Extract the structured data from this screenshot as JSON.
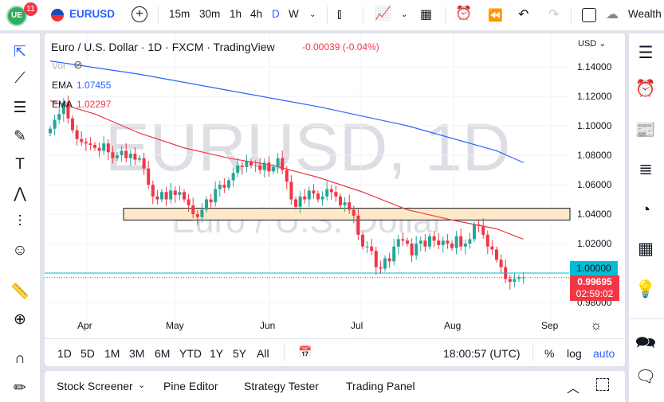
{
  "topbar": {
    "badge": "11",
    "symbol": "EURUSD",
    "intervals": [
      "15m",
      "30m",
      "1h",
      "4h",
      "D",
      "W"
    ],
    "active_interval": "D",
    "wealth": "Wealth"
  },
  "legend": {
    "title": "Euro / U.S. Dollar · 1D · FXCM · TradingView",
    "change": "-0.00039 (-0.04%)",
    "vol": "Vol",
    "ema1_label": "EMA",
    "ema1_value": "1.07455",
    "ema2_label": "EMA",
    "ema2_value": "1.02297"
  },
  "watermark": {
    "symbol": "EURUSD, 1D",
    "name": "Euro / U.S. Dollar"
  },
  "price_scale": {
    "currency": "USD",
    "ticks": [
      "1.14000",
      "1.12000",
      "1.10000",
      "1.08000",
      "1.06000",
      "1.04000",
      "1.02000",
      "1.00000",
      "0.98000"
    ],
    "alert_label": "1.00000",
    "last_price": "0.99695",
    "countdown": "02:59:02"
  },
  "time_axis": [
    "Apr",
    "May",
    "Jun",
    "Jul",
    "Aug",
    "Sep"
  ],
  "ranges": [
    "1D",
    "5D",
    "1M",
    "3M",
    "6M",
    "YTD",
    "1Y",
    "5Y",
    "All"
  ],
  "clock": "18:00:57 (UTC)",
  "scale_opts": {
    "pct": "%",
    "log": "log",
    "auto": "auto"
  },
  "bottom_tabs": [
    "Stock Screener",
    "Pine Editor",
    "Strategy Tester",
    "Trading Panel"
  ],
  "colors": {
    "up": "#26a69a",
    "down": "#f23645",
    "ema_fast": "#f23645",
    "ema_slow": "#2962ff",
    "accent": "#2962ff",
    "alert": "#00bcd4"
  },
  "chart_data": {
    "type": "candlestick",
    "ylim": [
      0.97,
      1.155
    ],
    "closes": [
      1.098,
      1.104,
      1.108,
      1.116,
      1.105,
      1.097,
      1.091,
      1.089,
      1.088,
      1.087,
      1.085,
      1.083,
      1.088,
      1.082,
      1.078,
      1.08,
      1.083,
      1.078,
      1.081,
      1.077,
      1.078,
      1.071,
      1.06,
      1.052,
      1.05,
      1.055,
      1.05,
      1.056,
      1.053,
      1.055,
      1.05,
      1.046,
      1.04,
      1.038,
      1.043,
      1.05,
      1.048,
      1.057,
      1.06,
      1.058,
      1.063,
      1.068,
      1.073,
      1.072,
      1.076,
      1.073,
      1.073,
      1.07,
      1.075,
      1.069,
      1.072,
      1.078,
      1.07,
      1.062,
      1.05,
      1.045,
      1.052,
      1.05,
      1.056,
      1.054,
      1.05,
      1.052,
      1.057,
      1.055,
      1.052,
      1.046,
      1.048,
      1.043,
      1.039,
      1.026,
      1.018,
      1.018,
      1.015,
      1.004,
      1.003,
      1.01,
      1.008,
      1.018,
      1.023,
      1.022,
      1.02,
      1.012,
      1.02,
      1.022,
      1.018,
      1.025,
      1.022,
      1.019,
      1.022,
      1.02,
      1.017,
      1.025,
      1.018,
      1.02,
      1.023,
      1.033,
      1.032,
      1.026,
      1.018,
      1.016,
      1.009,
      1.004,
      0.996,
      0.994,
      0.996,
      0.997,
      0.997
    ],
    "ema_slow": [
      [
        0,
        1.144
      ],
      [
        20,
        1.135
      ],
      [
        40,
        1.124
      ],
      [
        60,
        1.113
      ],
      [
        80,
        1.1
      ],
      [
        100,
        1.083
      ],
      [
        106,
        1.075
      ]
    ],
    "ema_fast": [
      [
        0,
        1.117
      ],
      [
        10,
        1.108
      ],
      [
        20,
        1.095
      ],
      [
        30,
        1.085
      ],
      [
        40,
        1.078
      ],
      [
        50,
        1.073
      ],
      [
        60,
        1.065
      ],
      [
        70,
        1.055
      ],
      [
        80,
        1.043
      ],
      [
        90,
        1.036
      ],
      [
        100,
        1.03
      ],
      [
        106,
        1.023
      ]
    ],
    "zone": [
      1.036,
      1.044
    ],
    "alert_level": 1.0,
    "last": 0.99695
  }
}
